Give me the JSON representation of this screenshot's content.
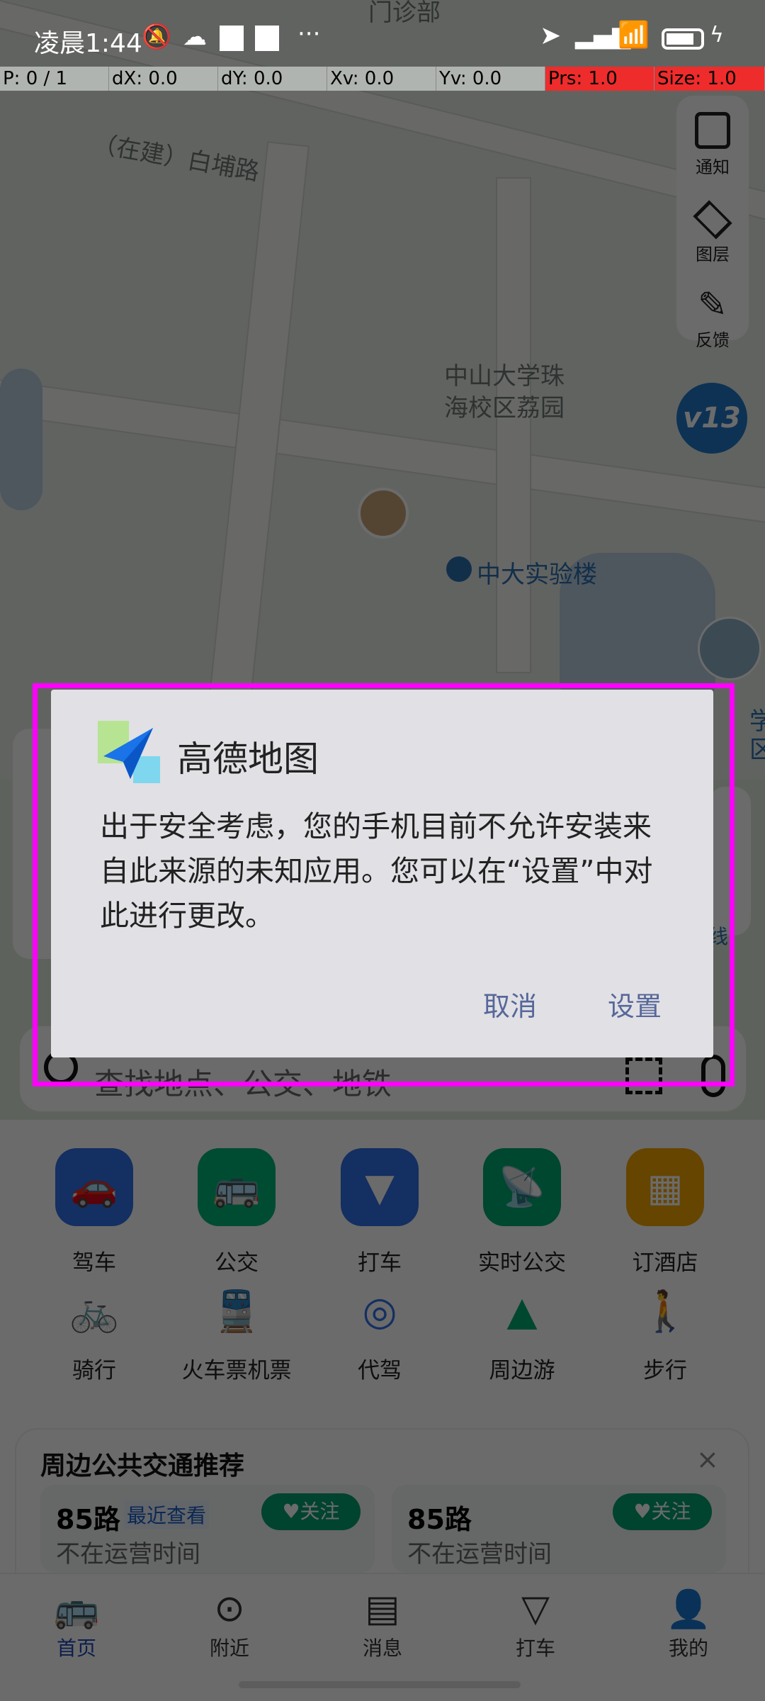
{
  "status_bar": {
    "time": "凌晨1:44",
    "more": "···"
  },
  "debug_bar": [
    "P: 0 / 1",
    "dX: 0.0",
    "dY: 0.0",
    "Xv: 0.0",
    "Yv: 0.0",
    "Prs: 1.0",
    "Size: 1.0"
  ],
  "map": {
    "labels": [
      "门诊部",
      "（在建）白埔路",
      "中山大学珠",
      "海校区荔园",
      "中大实验楼",
      "学",
      "区",
      "线"
    ],
    "badge": "v13"
  },
  "right_toolbar": [
    {
      "label": "通知",
      "icon": "notice-icon"
    },
    {
      "label": "图层",
      "icon": "layers-icon"
    },
    {
      "label": "反馈",
      "icon": "feedback-icon"
    }
  ],
  "search": {
    "placeholder": "查找地点、公交、地铁"
  },
  "quick_grid": [
    {
      "label": "驾车",
      "icon": "car-icon",
      "color": "#2f6fe8"
    },
    {
      "label": "公交",
      "icon": "bus-icon",
      "color": "#00b578"
    },
    {
      "label": "打车",
      "icon": "taxi-icon",
      "color": "#2f6fe8"
    },
    {
      "label": "实时公交",
      "icon": "realtime-bus-icon",
      "color": "#00a870"
    },
    {
      "label": "订酒店",
      "icon": "hotel-icon",
      "color": "#f0a400"
    },
    {
      "label": "骑行",
      "icon": "bicycle-icon",
      "color": "#00a870"
    },
    {
      "label": "火车票机票",
      "icon": "train-icon",
      "color": "#2f6fe8"
    },
    {
      "label": "代驾",
      "icon": "steering-wheel-icon",
      "color": "#2f6fe8"
    },
    {
      "label": "周边游",
      "icon": "mountain-pin-icon",
      "color": "#00a870"
    },
    {
      "label": "步行",
      "icon": "walk-icon",
      "color": "#00a870"
    }
  ],
  "transit": {
    "title": "周边公共交通推荐",
    "cards": [
      {
        "route": "85路",
        "tag": "最近查看",
        "follow": "关注",
        "status": "不在运营时间"
      },
      {
        "route": "85路",
        "tag": "",
        "follow": "关注",
        "status": "不在运营时间"
      }
    ]
  },
  "bottom_nav": [
    {
      "label": "首页",
      "active": true
    },
    {
      "label": "附近"
    },
    {
      "label": "消息"
    },
    {
      "label": "打车"
    },
    {
      "label": "我的"
    }
  ],
  "dialog": {
    "title": "高德地图",
    "message": "出于安全考虑，您的手机目前不允许安装来自此来源的未知应用。您可以在“设置”中对此进行更改。",
    "cancel": "取消",
    "settings": "设置"
  },
  "colors": {
    "accent": "#1a47b8",
    "dialog_button": "#56689a",
    "highlight": "#ff00ff",
    "debug_red": "#ee2c2c"
  }
}
